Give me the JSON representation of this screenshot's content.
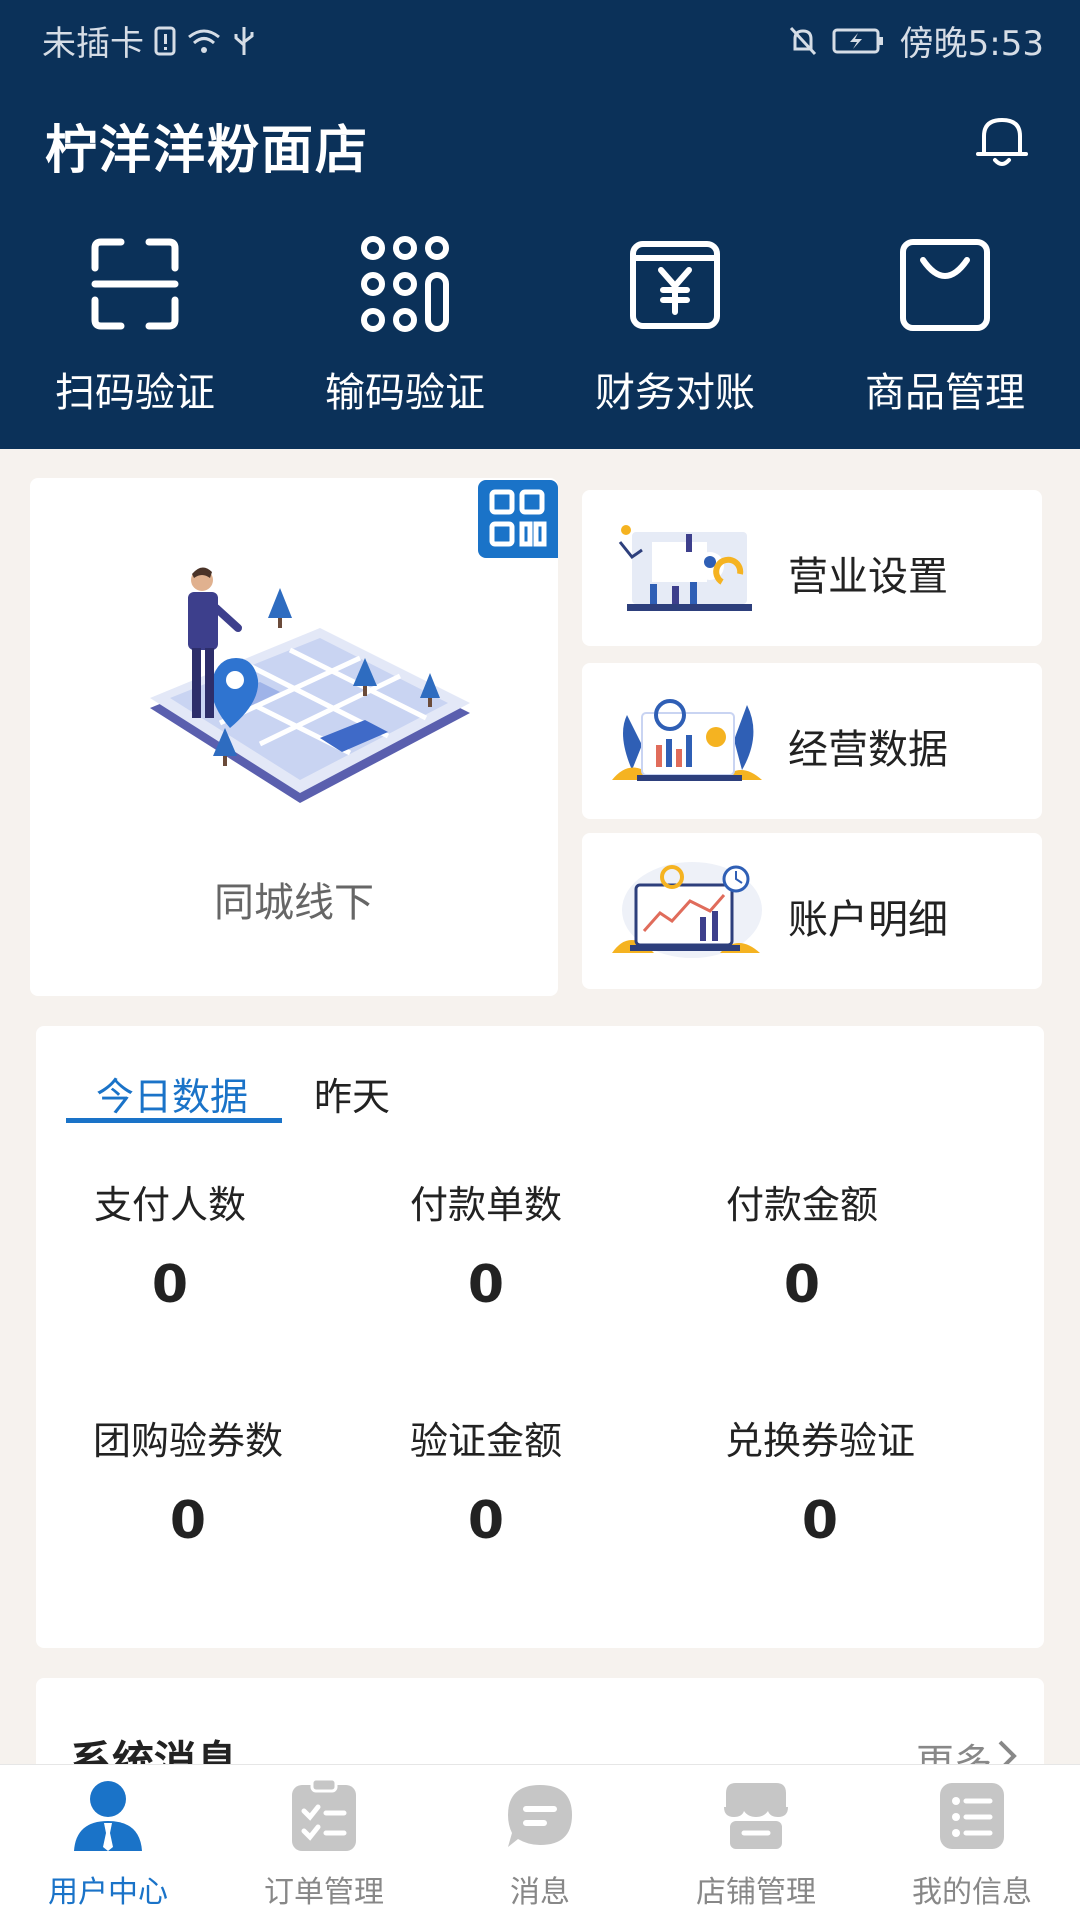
{
  "status_bar": {
    "carrier": "未插卡",
    "time": "傍晚5:53"
  },
  "header": {
    "store_name": "柠洋洋粉面店"
  },
  "quick_actions": [
    {
      "label": "扫码验证",
      "icon": "scan-icon"
    },
    {
      "label": "输码验证",
      "icon": "keypad-icon"
    },
    {
      "label": "财务对账",
      "icon": "yuan-wallet-icon"
    },
    {
      "label": "商品管理",
      "icon": "shopping-bag-icon"
    }
  ],
  "offline_card": {
    "label": "同城线下",
    "icon": "qr-code-icon"
  },
  "side_cards": [
    {
      "label": "营业设置"
    },
    {
      "label": "经营数据"
    },
    {
      "label": "账户明细"
    }
  ],
  "stats": {
    "tabs": [
      "今日数据",
      "昨天"
    ],
    "items": [
      {
        "label": "支付人数",
        "value": "0"
      },
      {
        "label": "付款单数",
        "value": "0"
      },
      {
        "label": "付款金额",
        "value": "0"
      },
      {
        "label": "团购验券数",
        "value": "0"
      },
      {
        "label": "验证金额",
        "value": "0"
      },
      {
        "label": "兑换券验证",
        "value": "0"
      }
    ]
  },
  "messages": {
    "title": "系统消息",
    "more": "更多"
  },
  "bottom_nav": [
    {
      "label": "用户中心",
      "active": true
    },
    {
      "label": "订单管理",
      "active": false
    },
    {
      "label": "消息",
      "active": false
    },
    {
      "label": "店铺管理",
      "active": false
    },
    {
      "label": "我的信息",
      "active": false
    }
  ],
  "colors": {
    "header_bg": "#0b3159",
    "accent": "#1a73c8",
    "page_bg": "#f6f2ee"
  }
}
